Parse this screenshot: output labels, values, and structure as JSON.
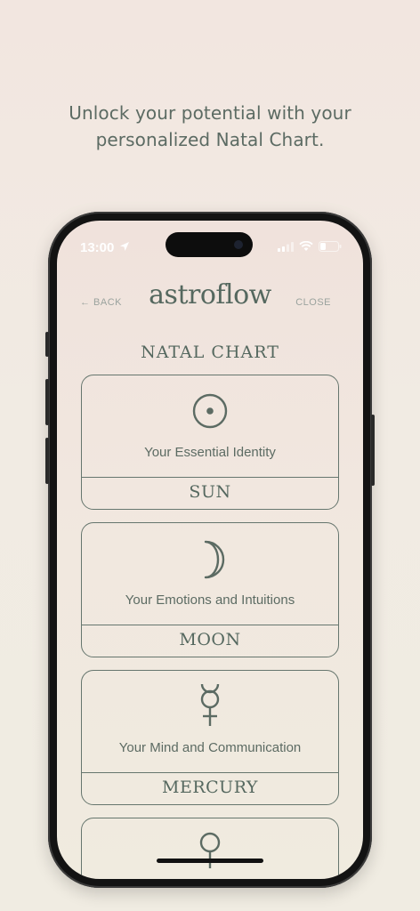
{
  "headline": {
    "line1": "Unlock your potential with your",
    "line2": "personalized Natal Chart."
  },
  "status_bar": {
    "time": "13:00",
    "location_icon": "location-arrow-icon",
    "signal_icon": "cellular-signal-icon",
    "wifi_icon": "wifi-icon",
    "battery_icon": "battery-icon"
  },
  "nav": {
    "back_label": "← BACK",
    "logo": "astroflow",
    "close_label": "CLOSE"
  },
  "page_title": "NATAL CHART",
  "cards": [
    {
      "icon": "sun-symbol-icon",
      "description": "Your Essential Identity",
      "planet": "SUN"
    },
    {
      "icon": "moon-symbol-icon",
      "description": "Your Emotions and Intuitions",
      "planet": "MOON"
    },
    {
      "icon": "mercury-symbol-icon",
      "description": "Your Mind and Communication",
      "planet": "MERCURY"
    },
    {
      "icon": "venus-symbol-icon",
      "description": "",
      "planet": ""
    }
  ],
  "colors": {
    "accent": "#5c6b63",
    "background": "#f1e9e1"
  }
}
